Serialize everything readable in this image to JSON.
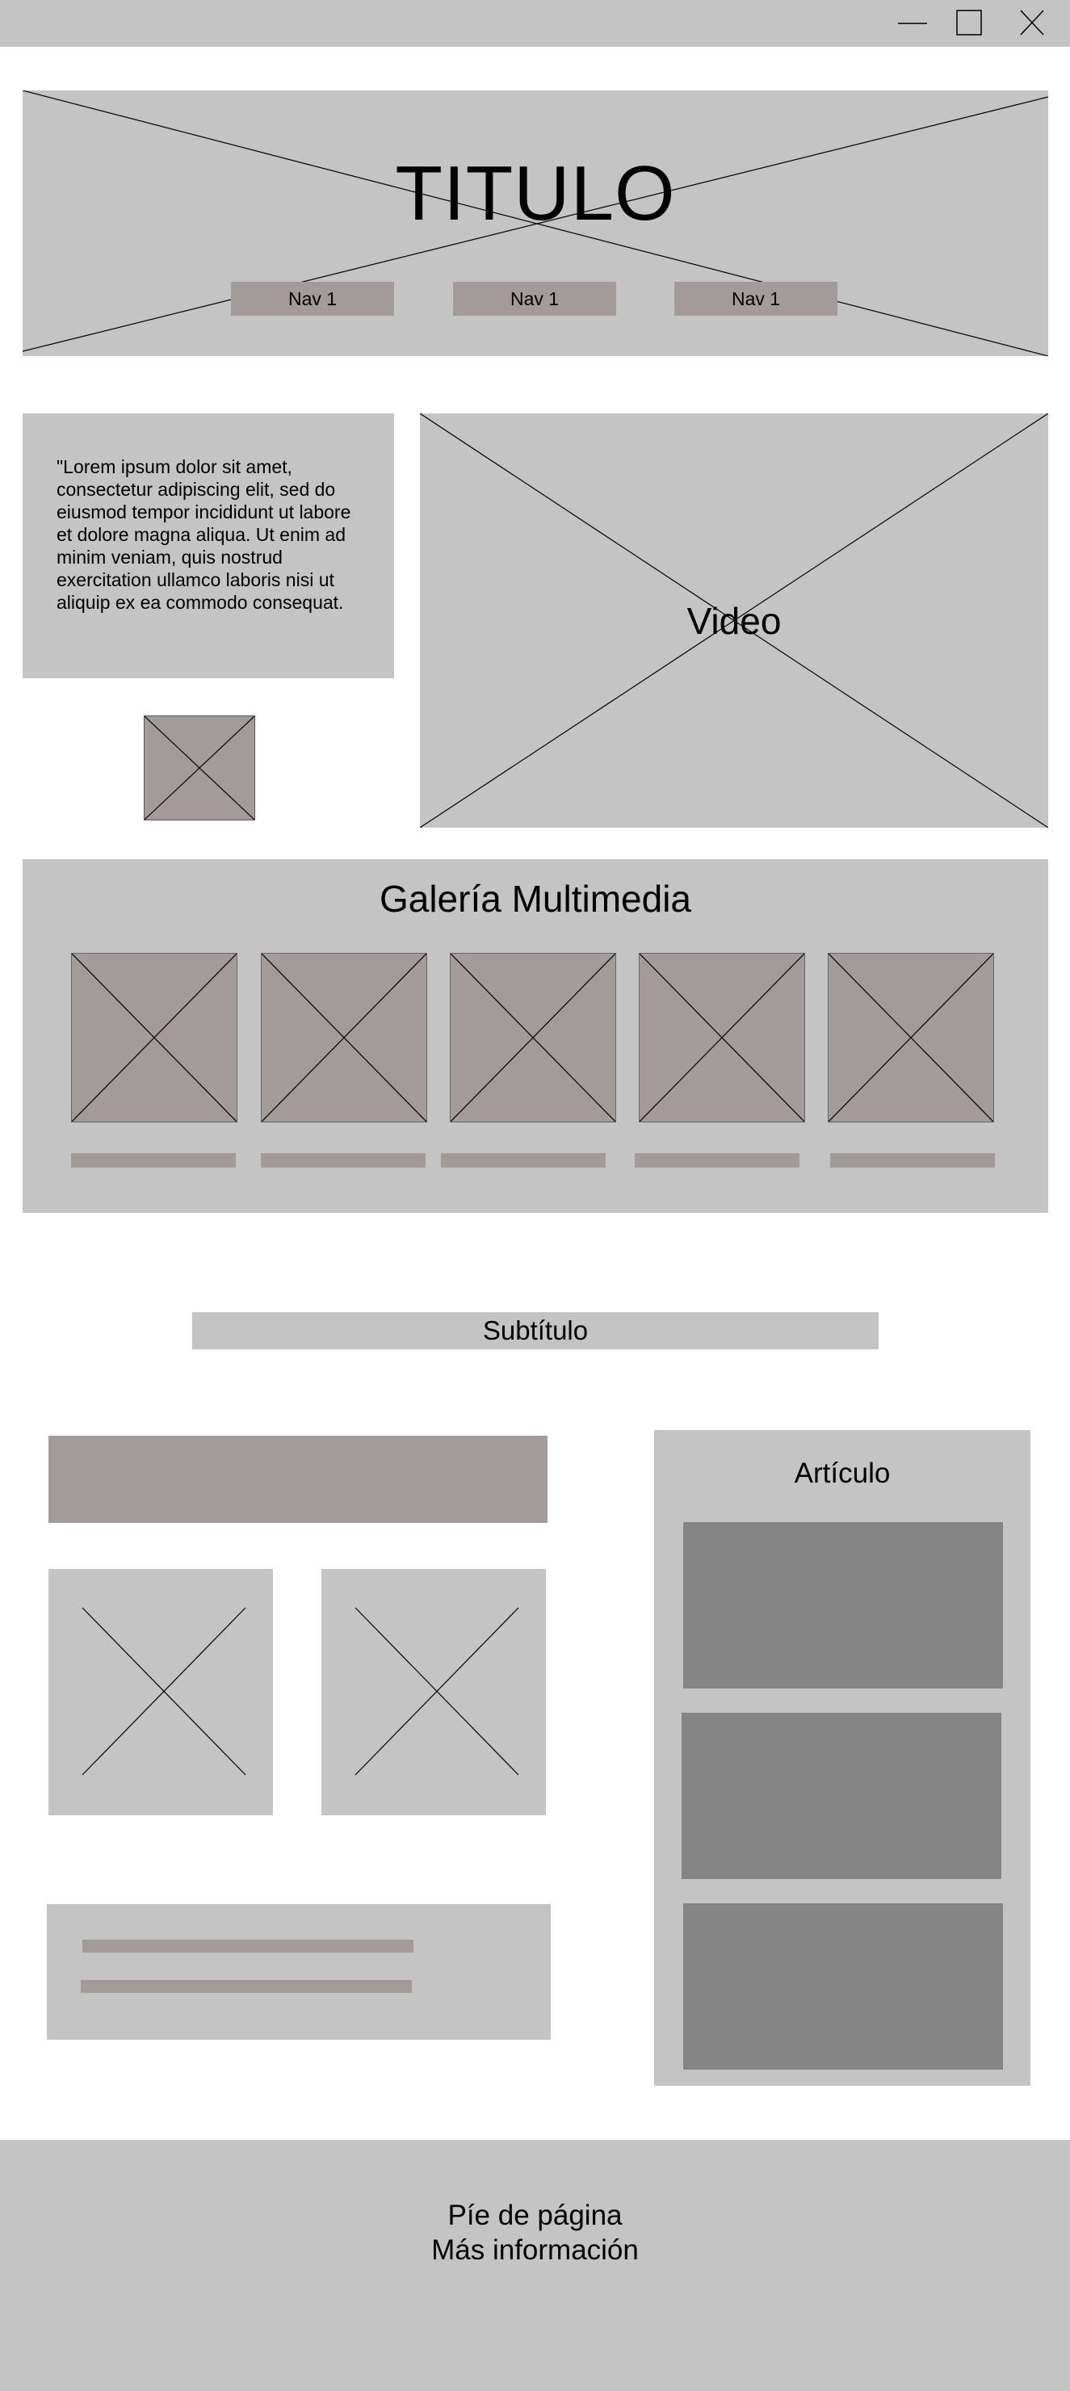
{
  "window": {
    "controls": [
      "minimize-icon",
      "maximize-icon",
      "close-icon"
    ]
  },
  "header": {
    "title": "TITULO",
    "nav": [
      "Nav 1",
      "Nav 1",
      "Nav 1"
    ]
  },
  "intro": {
    "text": "\"Lorem ipsum dolor sit amet, consectetur adipiscing elit, sed do eiusmod tempor incididunt ut labore et dolore magna aliqua. Ut enim ad minim veniam, quis nostrud exercitation ullamco laboris nisi ut aliquip ex ea commodo consequat."
  },
  "video": {
    "label": "Video"
  },
  "gallery": {
    "title": "Galería Multimedia",
    "item_count": 5
  },
  "subtitle": "Subtítulo",
  "article": {
    "title": "Artículo"
  },
  "footer": {
    "line1": "Píe de página",
    "line2": "Más información"
  },
  "colors": {
    "placeholder_gray": "#c4c4c4",
    "placeholder_mauve": "#a39a9a",
    "placeholder_dark": "#858585",
    "background": "#ffffff"
  }
}
